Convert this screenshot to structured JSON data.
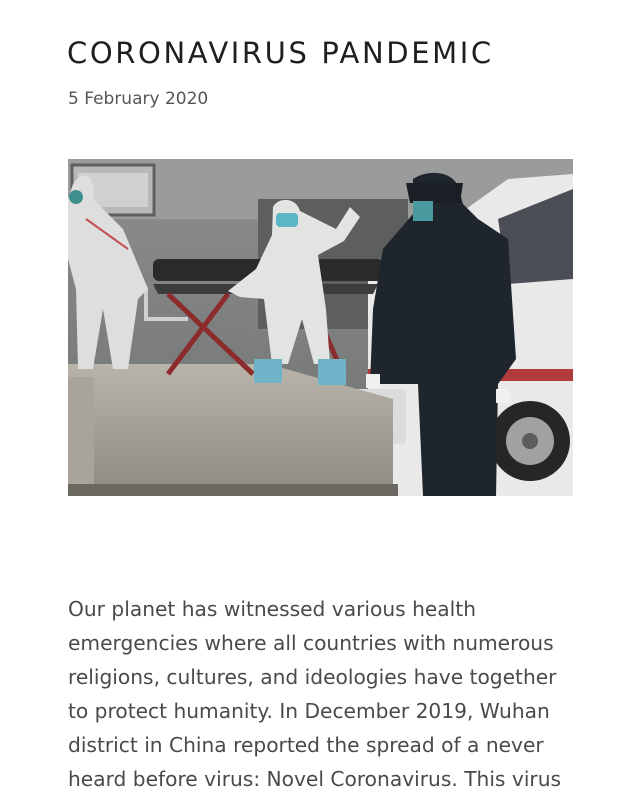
{
  "article": {
    "title": "CORONAVIRUS PANDEMIC",
    "date": "5 February 2020",
    "image": {
      "alt_kind": "photo",
      "subject": "medical workers in protective suits moving a patient on a stretcher next to an ambulance, security guard in foreground"
    },
    "body_lines": [
      "Our planet has witnessed various health",
      "emergencies where all countries with numerous",
      "religions, cultures, and ideologies have together",
      "to protect humanity. In December 2019, Wuhan",
      "district in China reported the spread of a never",
      "heard before virus: Novel Coronavirus. This virus"
    ]
  },
  "colors": {
    "title": "#1f1f1f",
    "text": "#4a4a4a",
    "background": "#ffffff"
  }
}
